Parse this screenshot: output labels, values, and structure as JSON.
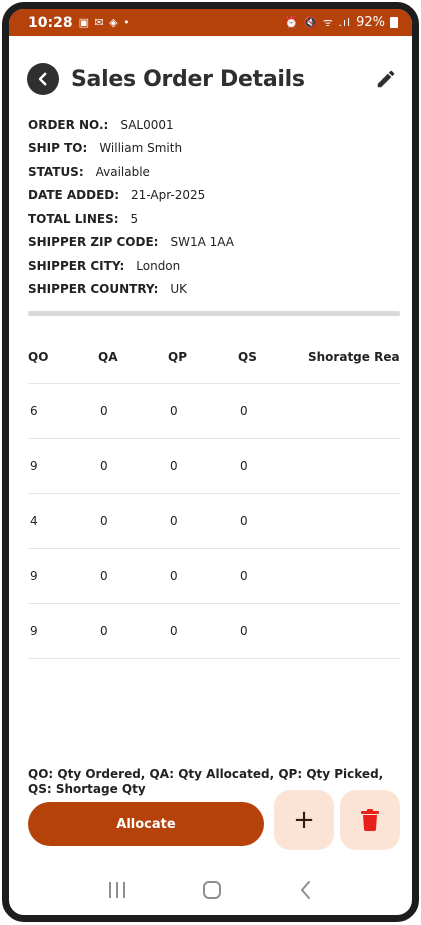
{
  "status_bar": {
    "time": "10:28",
    "left_icons": "▣ ✉ ◈ •",
    "right_icons": "⏰ 🔇 ᯤ .ıl",
    "battery": "92%"
  },
  "header": {
    "title": "Sales Order Details",
    "back_icon": "arrow-left-icon",
    "edit_icon": "pencil-icon"
  },
  "order_info": [
    {
      "label": "ORDER NO.:",
      "value": "SAL0001"
    },
    {
      "label": "SHIP TO:",
      "value": "William Smith"
    },
    {
      "label": "STATUS:",
      "value": "Available"
    },
    {
      "label": "DATE ADDED:",
      "value": "21-Apr-2025"
    },
    {
      "label": "TOTAL LINES:",
      "value": "5"
    },
    {
      "label": "SHIPPER ZIP CODE:",
      "value": "SW1A 1AA"
    },
    {
      "label": "SHIPPER CITY:",
      "value": "London"
    },
    {
      "label": "SHIPPER COUNTRY:",
      "value": "UK"
    }
  ],
  "table": {
    "columns": [
      "QO",
      "QA",
      "QP",
      "QS",
      "Shoratge Reas"
    ],
    "rows": [
      [
        "6",
        "0",
        "0",
        "0",
        ""
      ],
      [
        "9",
        "0",
        "0",
        "0",
        ""
      ],
      [
        "4",
        "0",
        "0",
        "0",
        ""
      ],
      [
        "9",
        "0",
        "0",
        "0",
        ""
      ],
      [
        "9",
        "0",
        "0",
        "0",
        ""
      ]
    ]
  },
  "legend": "QO: Qty Ordered, QA: Qty Allocated, QP: Qty Picked, QS: Shortage Qty",
  "actions": {
    "allocate_label": "Allocate",
    "add_label": "+",
    "delete_icon": "trash-icon"
  },
  "colors": {
    "brand": "#b5410b",
    "light_accent": "#fbe3d6",
    "delete_red": "#e8211d"
  }
}
